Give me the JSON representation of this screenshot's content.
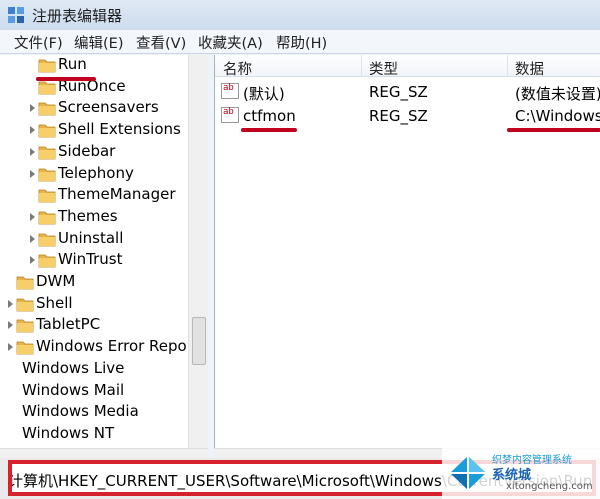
{
  "window": {
    "title": "注册表编辑器"
  },
  "menu": {
    "items": [
      "文件(F)",
      "编辑(E)",
      "查看(V)",
      "收藏夹(A)",
      "帮助(H)"
    ]
  },
  "tree": {
    "items": [
      {
        "label": "Run",
        "expandable": false,
        "indent": 1
      },
      {
        "label": "RunOnce",
        "expandable": false,
        "indent": 1
      },
      {
        "label": "Screensavers",
        "expandable": true,
        "indent": 1
      },
      {
        "label": "Shell Extensions",
        "expandable": true,
        "indent": 1
      },
      {
        "label": "Sidebar",
        "expandable": true,
        "indent": 1
      },
      {
        "label": "Telephony",
        "expandable": true,
        "indent": 1
      },
      {
        "label": "ThemeManager",
        "expandable": false,
        "indent": 1
      },
      {
        "label": "Themes",
        "expandable": true,
        "indent": 1
      },
      {
        "label": "Uninstall",
        "expandable": true,
        "indent": 1
      },
      {
        "label": "WinTrust",
        "expandable": true,
        "indent": 1
      },
      {
        "label": "DWM",
        "expandable": false,
        "indent": 0
      },
      {
        "label": "Shell",
        "expandable": true,
        "indent": 0
      },
      {
        "label": "TabletPC",
        "expandable": true,
        "indent": 0
      },
      {
        "label": "Windows Error Repo",
        "expandable": true,
        "indent": 0
      },
      {
        "label": "Windows Live",
        "expandable": false,
        "indent": -1
      },
      {
        "label": "Windows Mail",
        "expandable": false,
        "indent": -1
      },
      {
        "label": "Windows Media",
        "expandable": false,
        "indent": -1
      },
      {
        "label": "Windows NT",
        "expandable": false,
        "indent": -1
      }
    ]
  },
  "values": {
    "columns": [
      "名称",
      "类型",
      "数据"
    ],
    "rows": [
      {
        "name": "(默认)",
        "type": "REG_SZ",
        "data": "(数值未设置)"
      },
      {
        "name": "ctfmon",
        "type": "REG_SZ",
        "data": "C:\\Windows"
      }
    ]
  },
  "status": {
    "path": "计算机\\HKEY_CURRENT_USER\\Software\\Microsoft\\Windows\\CurrentVersion\\Run"
  },
  "watermark": {
    "line1": "系统城",
    "line2": "织梦内容管理系统",
    "line3": "xitongcheng.com"
  },
  "colors": {
    "highlight": "#c0001e",
    "status_border": "#d7222e",
    "folder": "#e8b44a"
  }
}
